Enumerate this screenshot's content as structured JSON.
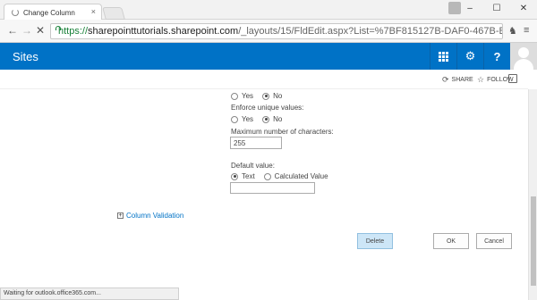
{
  "browser": {
    "tab_title": "Change Column",
    "tab_close": "×",
    "window_buttons": [
      "–",
      "☐",
      "✕"
    ],
    "url": {
      "scheme": "https://",
      "host": "sharepointtutorials.sharepoint.com",
      "path": "/_layouts/15/FldEdit.aspx?List=%7BF815127B-DAF0-467B-B398-E88207"
    },
    "status_text": "Waiting for outlook.office365.com..."
  },
  "suite": {
    "site_title": "Sites",
    "settings_icon": "gear-icon",
    "help_label": "?"
  },
  "actions": {
    "share": "SHARE",
    "follow": "FOLLOW"
  },
  "form": {
    "yes_label": "Yes",
    "no_label": "No",
    "enforce_unique_label": "Enforce unique values:",
    "max_chars_label": "Maximum number of characters:",
    "max_chars_value": "255",
    "default_value_label": "Default value:",
    "default_text_option": "Text",
    "default_calculated_option": "Calculated Value",
    "default_value_input": "",
    "column_validation_link": "Column Validation",
    "expand_glyph": "+"
  },
  "buttons": {
    "delete": "Delete",
    "ok": "OK",
    "cancel": "Cancel"
  }
}
